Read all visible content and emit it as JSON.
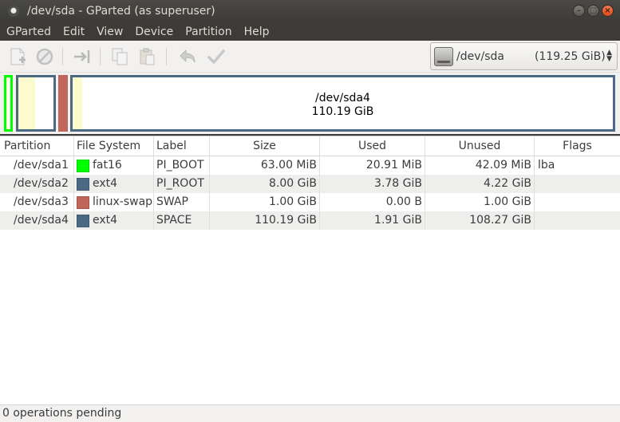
{
  "window": {
    "title": "/dev/sda - GParted (as superuser)"
  },
  "menu": [
    "GParted",
    "Edit",
    "View",
    "Device",
    "Partition",
    "Help"
  ],
  "toolbar": {
    "icons": [
      "new-partition-icon",
      "delete-icon",
      "resize-move-icon",
      "copy-icon",
      "paste-icon",
      "undo-icon",
      "apply-icon"
    ],
    "device": {
      "name": "/dev/sda",
      "size": "(119.25 GiB)"
    }
  },
  "map": {
    "selected": {
      "name": "/dev/sda4",
      "size": "110.19 GiB"
    },
    "colors": {
      "fat16": "#00ff00",
      "ext4": "#4b6983",
      "linux-swap": "#c1665a",
      "used": "#fcfbcd",
      "unused": "#ffffff"
    },
    "usage": {
      "sda1": 0.33,
      "sda2": 0.47,
      "sda3": 1.0,
      "sda4": 0.017
    }
  },
  "table": {
    "headers": [
      "Partition",
      "File System",
      "Label",
      "Size",
      "Used",
      "Unused",
      "Flags"
    ],
    "rows": [
      {
        "partition": "/dev/sda1",
        "fs": "fat16",
        "color": "#00ff00",
        "label": "PI_BOOT",
        "size": "63.00 MiB",
        "used": "20.91 MiB",
        "unused": "42.09 MiB",
        "flags": "lba"
      },
      {
        "partition": "/dev/sda2",
        "fs": "ext4",
        "color": "#4b6983",
        "label": "PI_ROOT",
        "size": "8.00 GiB",
        "used": "3.78 GiB",
        "unused": "4.22 GiB",
        "flags": ""
      },
      {
        "partition": "/dev/sda3",
        "fs": "linux-swap",
        "color": "#c1665a",
        "label": "SWAP",
        "size": "1.00 GiB",
        "used": "0.00 B",
        "unused": "1.00 GiB",
        "flags": ""
      },
      {
        "partition": "/dev/sda4",
        "fs": "ext4",
        "color": "#4b6983",
        "label": "SPACE",
        "size": "110.19 GiB",
        "used": "1.91 GiB",
        "unused": "108.27 GiB",
        "flags": ""
      }
    ]
  },
  "status": {
    "text": "0 operations pending"
  }
}
